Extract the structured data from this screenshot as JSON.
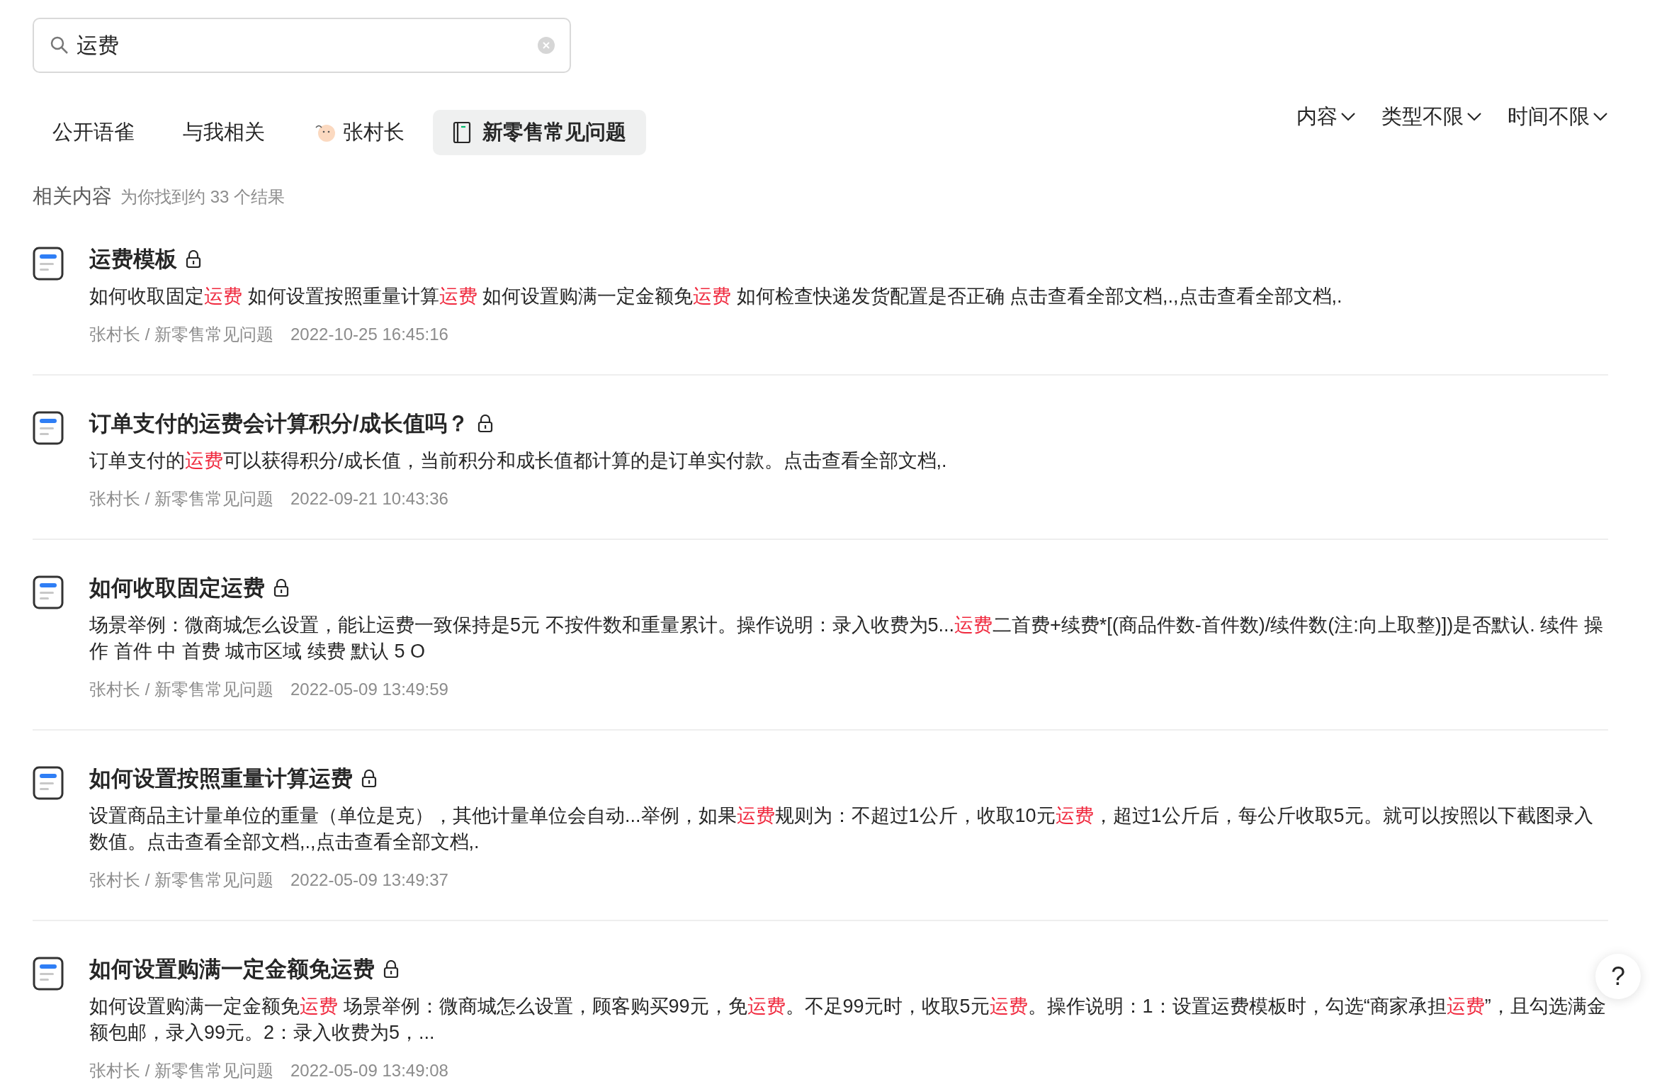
{
  "search": {
    "value": "运费"
  },
  "tabs": [
    {
      "label": "公开语雀",
      "kind": "plain",
      "selected": false
    },
    {
      "label": "与我相关",
      "kind": "plain",
      "selected": false
    },
    {
      "label": "张村长",
      "kind": "user",
      "selected": false
    },
    {
      "label": "新零售常见问题",
      "kind": "book",
      "selected": true
    }
  ],
  "filters": [
    "内容",
    "类型不限",
    "时间不限"
  ],
  "summary": {
    "heading": "相关内容",
    "count": "为你找到约 33 个结果"
  },
  "results": [
    {
      "title": "运费模板",
      "locked": true,
      "snippet": [
        {
          "text": "如何收取固定",
          "highlight": false
        },
        {
          "text": "运费",
          "highlight": true
        },
        {
          "text": " 如何设置按照重量计算",
          "highlight": false
        },
        {
          "text": "运费",
          "highlight": true
        },
        {
          "text": " 如何设置购满一定金额免",
          "highlight": false
        },
        {
          "text": "运费",
          "highlight": true
        },
        {
          "text": " 如何检查快递发货配置是否正确 点击查看全部文档,.,点击查看全部文档,.",
          "highlight": false
        }
      ],
      "path": "张村长 / 新零售常见问题",
      "time": "2022-10-25 16:45:16"
    },
    {
      "title": "订单支付的运费会计算积分/成长值吗？",
      "locked": true,
      "snippet": [
        {
          "text": "订单支付的",
          "highlight": false
        },
        {
          "text": "运费",
          "highlight": true
        },
        {
          "text": "可以获得积分/成长值，当前积分和成长值都计算的是订单实付款。点击查看全部文档,.",
          "highlight": false
        }
      ],
      "path": "张村长 / 新零售常见问题",
      "time": "2022-09-21 10:43:36"
    },
    {
      "title": "如何收取固定运费",
      "locked": true,
      "snippet": [
        {
          "text": "场景举例：微商城怎么设置，能让运费一致保持是5元 不按件数和重量累计。操作说明：录入收费为5...",
          "highlight": false
        },
        {
          "text": "运费",
          "highlight": true
        },
        {
          "text": "二首费+续费*[(商品件数-首件数)/续件数(注:向上取整)])是否默认. 续件 操作 首件 中 首费 城市区域 续费 默认 5 O",
          "highlight": false
        }
      ],
      "path": "张村长 / 新零售常见问题",
      "time": "2022-05-09 13:49:59"
    },
    {
      "title": "如何设置按照重量计算运费",
      "locked": true,
      "snippet": [
        {
          "text": "设置商品主计量单位的重量（单位是克），其他计量单位会自动...举例，如果",
          "highlight": false
        },
        {
          "text": "运费",
          "highlight": true
        },
        {
          "text": "规则为：不超过1公斤，收取10元",
          "highlight": false
        },
        {
          "text": "运费",
          "highlight": true
        },
        {
          "text": "，超过1公斤后，每公斤收取5元。就可以按照以下截图录入数值。点击查看全部文档,.,点击查看全部文档,.",
          "highlight": false
        }
      ],
      "path": "张村长 / 新零售常见问题",
      "time": "2022-05-09 13:49:37"
    },
    {
      "title": "如何设置购满一定金额免运费",
      "locked": true,
      "snippet": [
        {
          "text": "如何设置购满一定金额免",
          "highlight": false
        },
        {
          "text": "运费",
          "highlight": true
        },
        {
          "text": " 场景举例：微商城怎么设置，顾客购买99元，免",
          "highlight": false
        },
        {
          "text": "运费",
          "highlight": true
        },
        {
          "text": "。不足99元时，收取5元",
          "highlight": false
        },
        {
          "text": "运费",
          "highlight": true
        },
        {
          "text": "。操作说明：1：设置运费模板时，勾选“商家承担",
          "highlight": false
        },
        {
          "text": "运费",
          "highlight": true
        },
        {
          "text": "”，且勾选满金额包邮，录入99元。2：录入收费为5，...",
          "highlight": false
        }
      ],
      "path": "张村长 / 新零售常见问题",
      "time": "2022-05-09 13:49:08"
    }
  ],
  "help": {
    "label": "?"
  }
}
